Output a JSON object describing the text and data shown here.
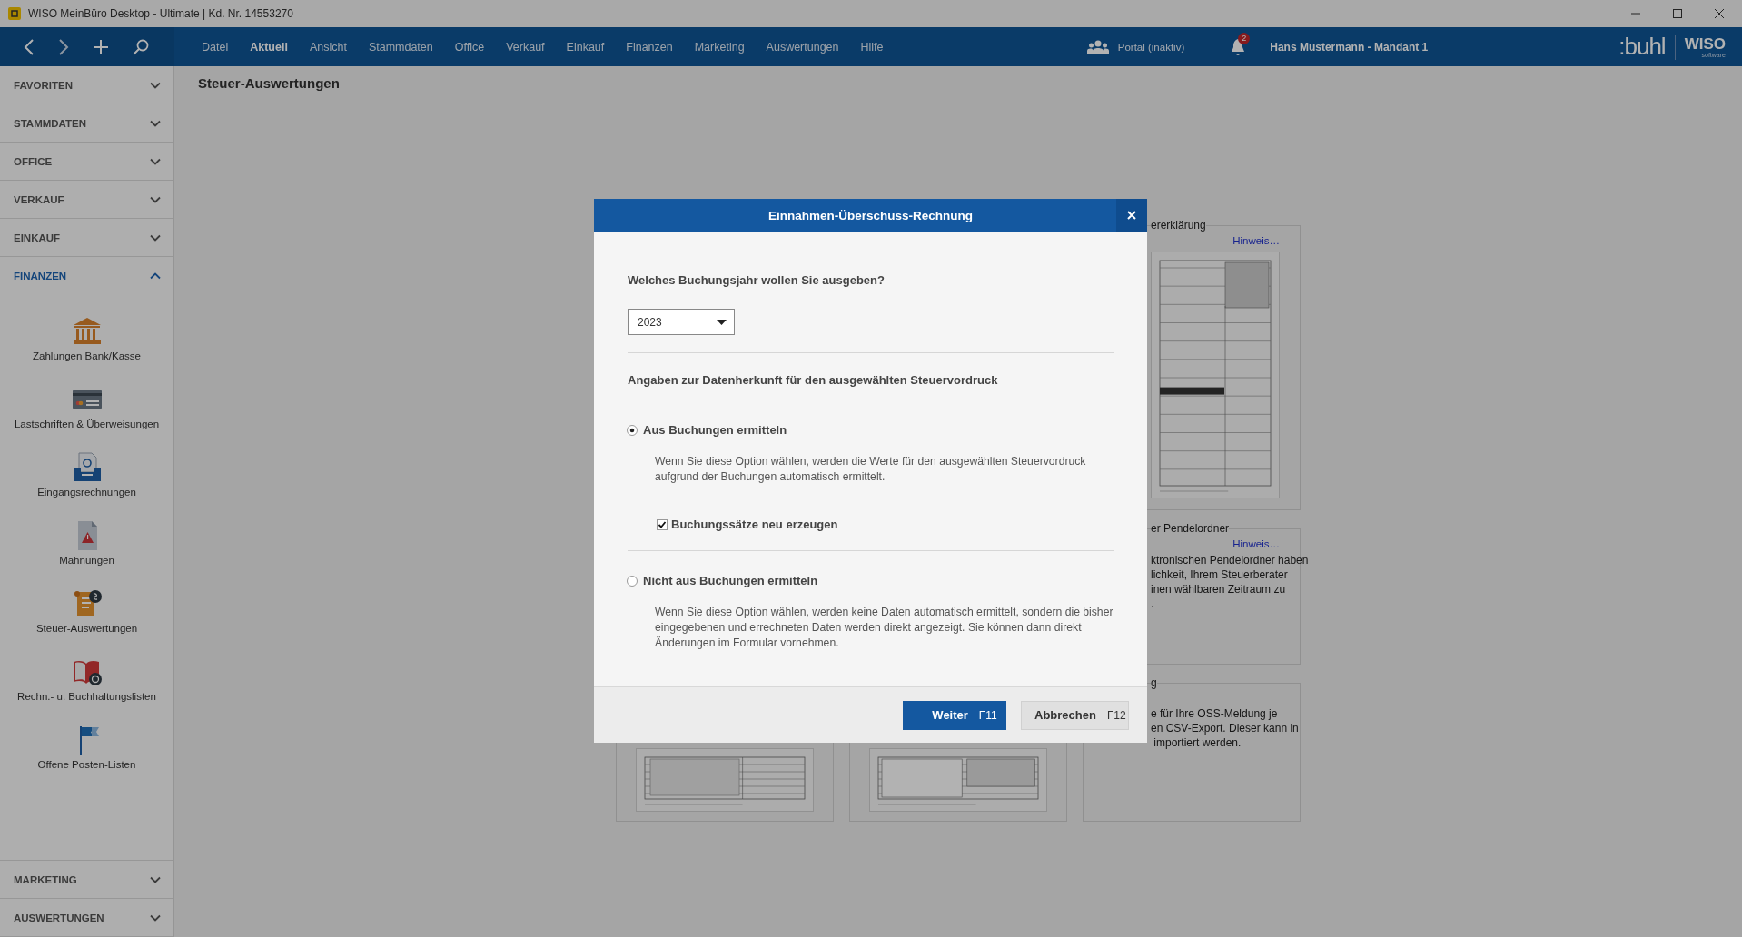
{
  "window": {
    "title": "WISO MeinBüro Desktop - Ultimate | Kd. Nr. 14553270"
  },
  "menu": [
    {
      "label": "Datei",
      "selected": false
    },
    {
      "label": "Aktuell",
      "selected": true
    },
    {
      "label": "Ansicht",
      "selected": false
    },
    {
      "label": "Stammdaten",
      "selected": false
    },
    {
      "label": "Office",
      "selected": false
    },
    {
      "label": "Verkauf",
      "selected": false
    },
    {
      "label": "Einkauf",
      "selected": false
    },
    {
      "label": "Finanzen",
      "selected": false
    },
    {
      "label": "Marketing",
      "selected": false
    },
    {
      "label": "Auswertungen",
      "selected": false
    },
    {
      "label": "Hilfe",
      "selected": false
    }
  ],
  "header": {
    "portal": "Portal (inaktiv)",
    "notification_count": "2",
    "user": "Hans Mustermann - Mandant 1",
    "logos": [
      ":buhl",
      "WISO"
    ],
    "logo_tagline": "software"
  },
  "sidebar": {
    "sections": [
      {
        "label": "FAVORITEN",
        "expanded": false
      },
      {
        "label": "STAMMDATEN",
        "expanded": false
      },
      {
        "label": "OFFICE",
        "expanded": false
      },
      {
        "label": "VERKAUF",
        "expanded": false
      },
      {
        "label": "EINKAUF",
        "expanded": false
      },
      {
        "label": "FINANZEN",
        "expanded": true,
        "items": [
          "Zahlungen Bank/Kasse",
          "Lastschriften & Überweisungen",
          "Eingangsrechnungen",
          "Mahnungen",
          "Steuer-Auswertungen",
          "Rechn.- u. Buchhaltungslisten",
          "Offene Posten-Listen"
        ]
      }
    ],
    "bottom_sections": [
      {
        "label": "MARKETING",
        "expanded": false
      },
      {
        "label": "AUSWERTUNGEN",
        "expanded": false
      }
    ]
  },
  "page": {
    "title": "Steuer-Auswertungen",
    "cards": [
      {
        "kind": "covered"
      },
      {
        "kind": "covered"
      },
      {
        "kind": "form",
        "title": "ererklärung",
        "link": "Hinweis…"
      },
      {
        "kind": "covered"
      },
      {
        "kind": "covered"
      },
      {
        "kind": "text",
        "title": "er Pendelordner",
        "link": "Hinweis…",
        "lines": [
          "ktronischen Pendelordner haben",
          "lichkeit, Ihrem Steuerberater",
          "inen wählbaren Zeitraum zu",
          "."
        ]
      },
      {
        "kind": "thumbnail"
      },
      {
        "kind": "thumbnail"
      },
      {
        "kind": "text",
        "title": "g",
        "lines": [
          "e für Ihre OSS-Meldung je",
          "en CSV-Export. Dieser kann in",
          " importiert werden."
        ]
      }
    ]
  },
  "dialog": {
    "title": "Einnahmen-Überschuss-Rechnung",
    "question": "Welches Buchungsjahr wollen Sie ausgeben?",
    "year": {
      "value": "2023"
    },
    "section_heading": "Angaben zur Datenherkunft für den ausgewählten Steuervordruck",
    "options": [
      {
        "label": "Aus Buchungen ermitteln",
        "selected": true,
        "description": "Wenn Sie diese Option wählen, werden die Werte für den ausgewählten Steuervordruck aufgrund der Buchungen automatisch ermittelt.",
        "checkbox": {
          "label": "Buchungssätze neu erzeugen",
          "checked": true
        }
      },
      {
        "label": "Nicht aus Buchungen ermitteln",
        "selected": false,
        "description": "Wenn Sie diese Option wählen, werden keine Daten automatisch ermittelt, sondern die bisher eingegebenen und errechneten Daten werden direkt angezeigt. Sie können dann direkt Änderungen im Formular vornehmen."
      }
    ],
    "buttons": [
      {
        "label": "Weiter",
        "shortcut": "F11",
        "kind": "primary"
      },
      {
        "label": "Abbrechen",
        "shortcut": "F12",
        "kind": "secondary"
      }
    ]
  }
}
